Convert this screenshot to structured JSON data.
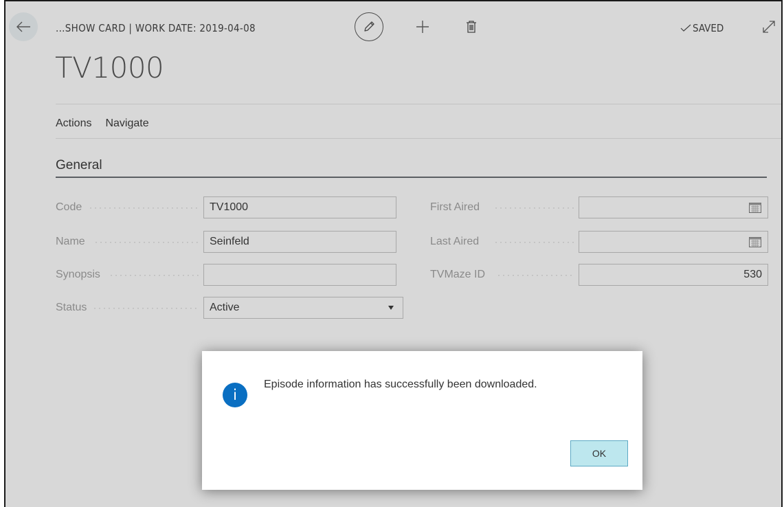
{
  "header": {
    "breadcrumb": "...SHOW CARD | WORK DATE: 2019-04-08",
    "saved_status": "SAVED"
  },
  "icons": {
    "back": "arrow-left-icon",
    "edit": "pencil-icon",
    "new": "plus-icon",
    "delete": "trash-icon",
    "saved": "checkmark-icon",
    "expand": "expand-icon",
    "calendar": "calendar-icon",
    "dropdown": "caret-down-icon",
    "info": "info-icon"
  },
  "page": {
    "title": "TV1000"
  },
  "menu": {
    "actions": "Actions",
    "navigate": "Navigate"
  },
  "section": {
    "title": "General"
  },
  "fields": {
    "code": {
      "label": "Code",
      "value": "TV1000"
    },
    "name": {
      "label": "Name",
      "value": "Seinfeld"
    },
    "synopsis": {
      "label": "Synopsis",
      "value": ""
    },
    "status": {
      "label": "Status",
      "value": "Active"
    },
    "first_aired": {
      "label": "First Aired",
      "value": ""
    },
    "last_aired": {
      "label": "Last Aired",
      "value": ""
    },
    "tvmaze_id": {
      "label": "TVMaze ID",
      "value": "530"
    }
  },
  "dialog": {
    "info_glyph": "i",
    "message": "Episode information has successfully been downloaded.",
    "ok_label": "OK"
  },
  "colors": {
    "background": "#d8d8d8",
    "info_icon": "#0a6fc2",
    "ok_button": "#bde7ee"
  }
}
